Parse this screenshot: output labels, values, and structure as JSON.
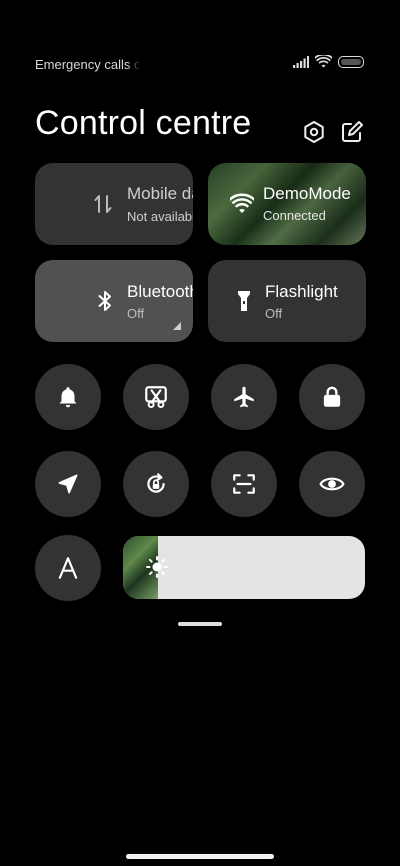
{
  "status": {
    "carrier_text": "Emergency calls only",
    "icons": [
      "signal-icon",
      "wifi-icon",
      "battery-icon"
    ]
  },
  "header": {
    "title": "Control centre",
    "icons": [
      "settings-icon",
      "edit-icon"
    ]
  },
  "tiles": {
    "mobile": {
      "title": "Mobile data",
      "subtitle": "Not available",
      "icon": "mobile-data-icon"
    },
    "wifi": {
      "title": "DemoMode",
      "subtitle": "Connected",
      "icon": "wifi-icon"
    },
    "bluetooth": {
      "title": "Bluetooth",
      "subtitle": "Off",
      "icon": "bluetooth-icon"
    },
    "flashlight": {
      "title": "Flashlight",
      "subtitle": "Off",
      "icon": "flashlight-icon"
    }
  },
  "toggles": [
    "notifications-bell-icon",
    "screenshot-scissors-icon",
    "airplane-mode-icon",
    "lock-screen-icon",
    "location-icon",
    "auto-rotate-icon",
    "scanner-icon",
    "reading-mode-eye-icon",
    "auto-brightness-a-icon"
  ],
  "brightness": {
    "level": 0.145,
    "icon": "brightness-sun-icon"
  },
  "colors": {
    "background": "#000000",
    "tile": "#333333",
    "tile_active": "#515151",
    "slider_track": "#e4e4e4"
  }
}
